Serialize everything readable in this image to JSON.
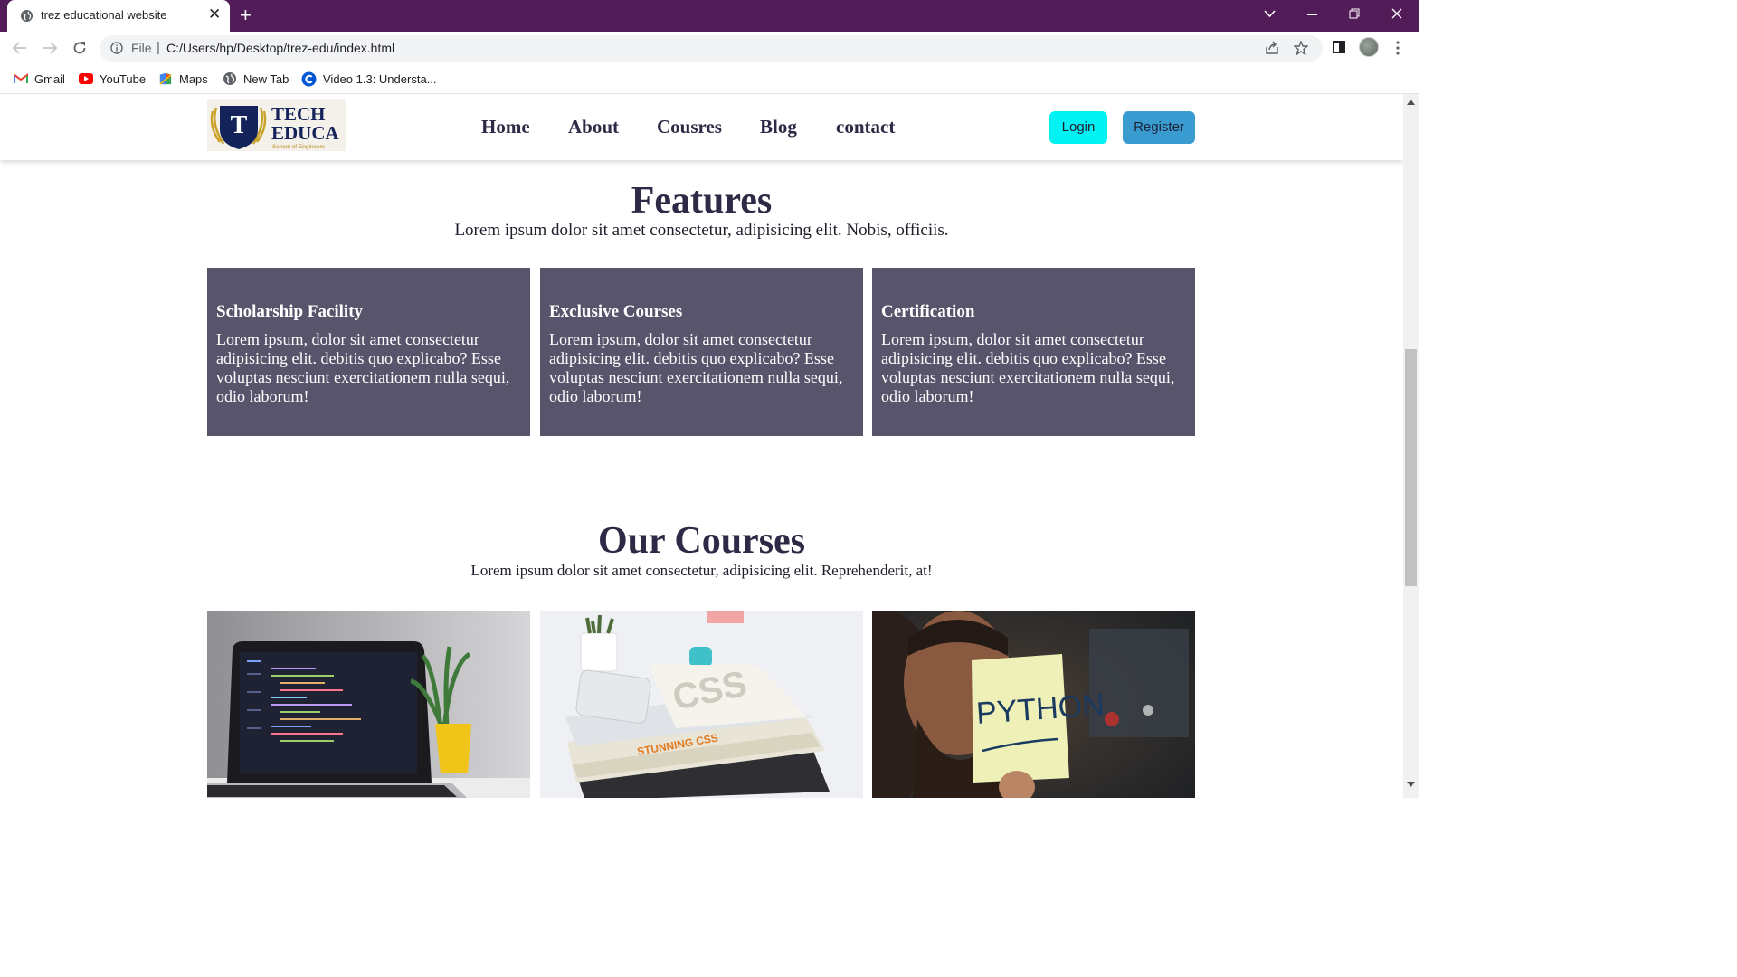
{
  "browser": {
    "tab_title": "trez educational website",
    "tab_close": "✕",
    "new_tab": "+",
    "address_scheme": "File",
    "address_separator": "|",
    "address_url": "C:/Users/hp/Desktop/trez-edu/index.html",
    "bookmarks": [
      {
        "label": "Gmail",
        "icon": "gmail-icon"
      },
      {
        "label": "YouTube",
        "icon": "youtube-icon"
      },
      {
        "label": "Maps",
        "icon": "maps-icon"
      },
      {
        "label": "New Tab",
        "icon": "globe-icon"
      },
      {
        "label": "Video 1.3: Understa...",
        "icon": "coursera-icon"
      }
    ],
    "colors": {
      "titlebar": "#511c57",
      "omnibox": "#f1f3f4"
    }
  },
  "site": {
    "logo": {
      "line1": "TECH",
      "line2": "EDUCA",
      "tagline": "School of Engineers",
      "badge_letter": "T"
    },
    "nav": [
      "Home",
      "About",
      "Cousres",
      "Blog",
      "contact"
    ],
    "login_label": "Login",
    "register_label": "Register",
    "colors": {
      "login": "#00f2f2",
      "register": "#3a9bd1",
      "card": "#57546b",
      "heading": "#2c2a45"
    }
  },
  "features": {
    "title": "Features",
    "subtitle": "Lorem ipsum dolor sit amet consectetur, adipisicing elit. Nobis, officiis.",
    "cards": [
      {
        "title": "Scholarship Facility",
        "text": "Lorem ipsum, dolor sit amet consectetur adipisicing elit. debitis quo explicabo? Esse voluptas nesciunt exercitationem nulla sequi, odio laborum!"
      },
      {
        "title": "Exclusive Courses",
        "text": "Lorem ipsum, dolor sit amet consectetur adipisicing elit. debitis quo explicabo? Esse voluptas nesciunt exercitationem nulla sequi, odio laborum!"
      },
      {
        "title": "Certification",
        "text": "Lorem ipsum, dolor sit amet consectetur adipisicing elit. debitis quo explicabo? Esse voluptas nesciunt exercitationem nulla sequi, odio laborum!"
      }
    ]
  },
  "courses": {
    "title": "Our Courses",
    "subtitle": "Lorem ipsum dolor sit amet consectetur, adipisicing elit. Reprehenderit, at!",
    "images": [
      {
        "name": "laptop-code-photo"
      },
      {
        "name": "css-books-photo",
        "book_text": "STUNNING CSS"
      },
      {
        "name": "python-note-photo",
        "note_text": "PYTHON"
      }
    ]
  }
}
